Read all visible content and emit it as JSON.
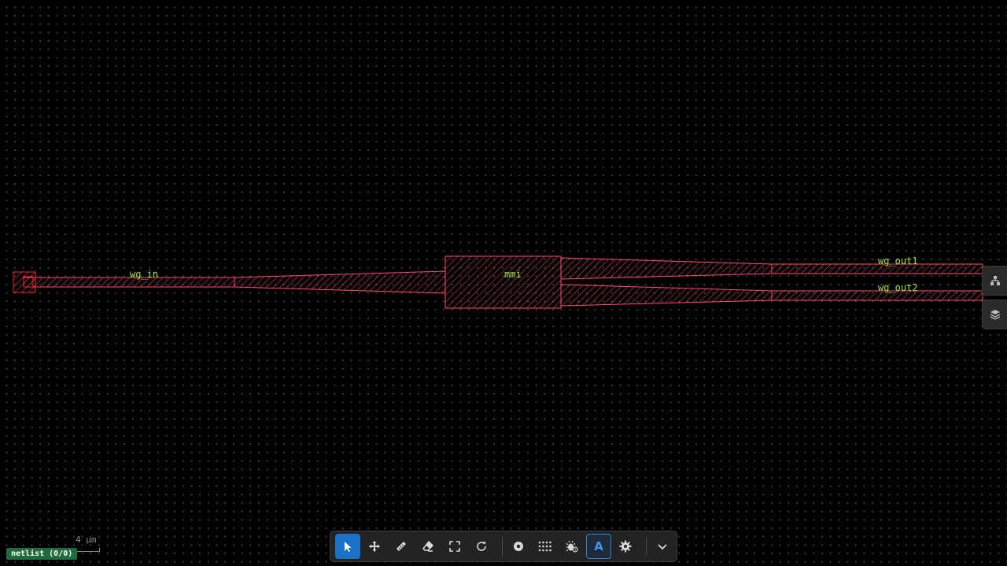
{
  "layout": {
    "labels": [
      {
        "id": "wg_in",
        "text": "wg_in"
      },
      {
        "id": "mmi",
        "text": "mmi"
      },
      {
        "id": "wg_out1",
        "text": "wg_out1"
      },
      {
        "id": "wg_out2",
        "text": "wg_out2"
      }
    ],
    "colors": {
      "background": "#000000",
      "grid_dots": "#4a4a4a",
      "shape_outline": "#ff4d6d",
      "shape_hatch": "#ff4d6d",
      "label_text": "#9be63a",
      "port_marker": "#ff2020"
    }
  },
  "scale_bar": {
    "label": "4 µm"
  },
  "status": {
    "netlist": "netlist (0/0)"
  },
  "side_panel": {
    "tabs": [
      {
        "icon": "hierarchy-icon"
      },
      {
        "icon": "layers-icon"
      }
    ]
  },
  "toolbar": {
    "tools": [
      {
        "icon": "select-arrow-icon",
        "state": "active"
      },
      {
        "icon": "move-icon",
        "state": "normal"
      },
      {
        "icon": "ruler-icon",
        "state": "normal"
      },
      {
        "icon": "eraser-icon",
        "state": "normal"
      },
      {
        "icon": "fit-view-icon",
        "state": "normal"
      },
      {
        "icon": "refresh-icon",
        "state": "normal"
      },
      {
        "icon": "target-icon",
        "state": "normal"
      },
      {
        "icon": "grid-icon",
        "state": "normal"
      },
      {
        "icon": "debug-icon",
        "state": "normal"
      },
      {
        "icon": "text-labels-icon",
        "state": "toggled",
        "glyph": "A"
      },
      {
        "icon": "settings-gear-icon",
        "state": "normal"
      },
      {
        "icon": "chevron-down-icon",
        "state": "normal"
      }
    ]
  }
}
